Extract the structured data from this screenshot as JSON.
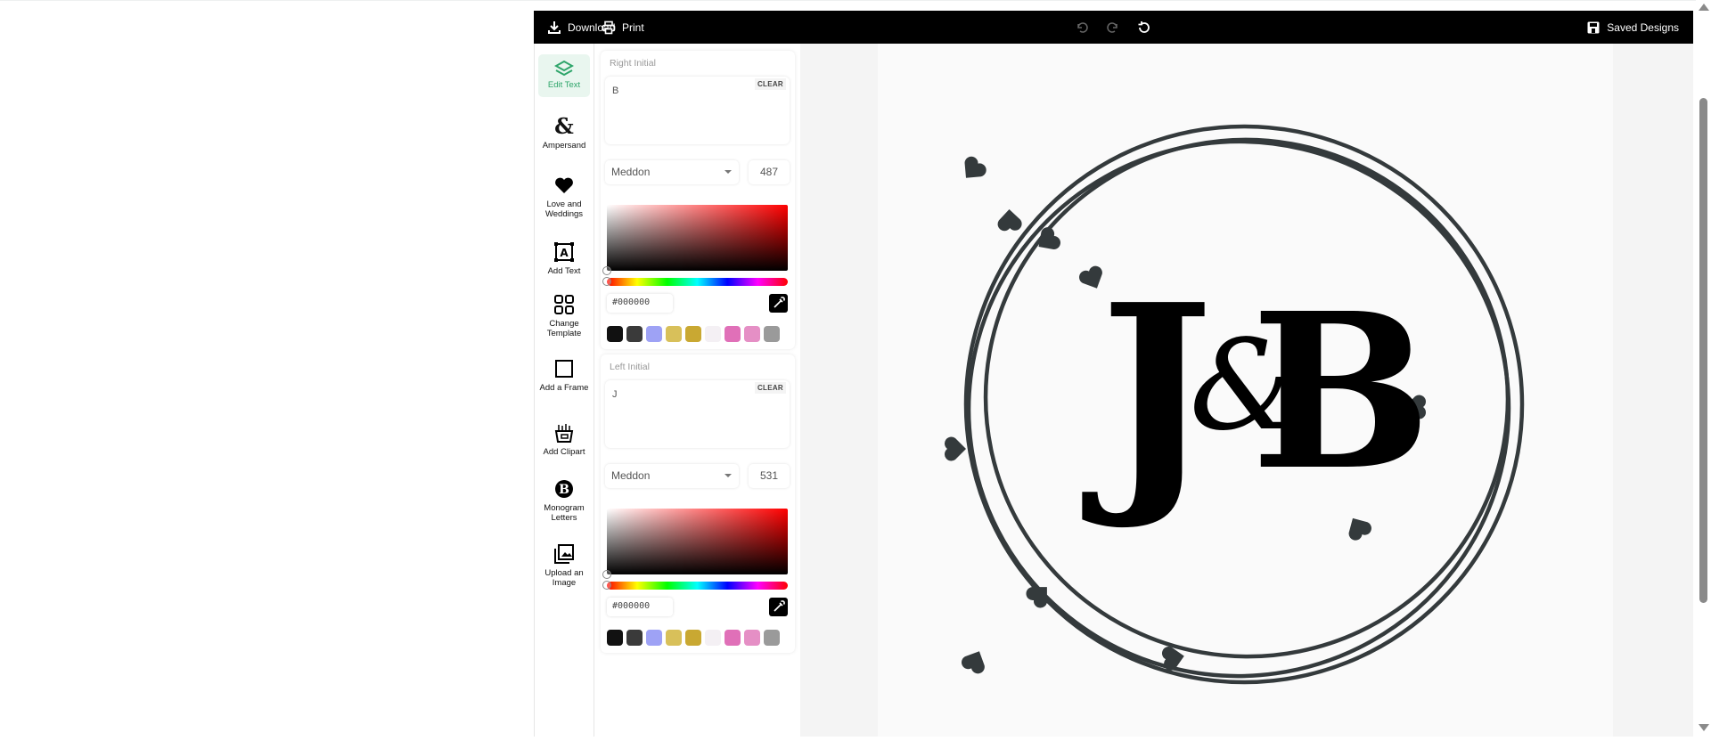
{
  "toolbar": {
    "download": "Download",
    "print": "Print",
    "saved_designs": "Saved Designs"
  },
  "sidebar": {
    "items": [
      {
        "label": "Edit Text",
        "icon": "layers-icon"
      },
      {
        "label": "Ampersand",
        "icon": "ampersand-icon"
      },
      {
        "label": "Love and Weddings",
        "icon": "heart-icon"
      },
      {
        "label": "Add Text",
        "icon": "text-box-icon"
      },
      {
        "label": "Change Template",
        "icon": "grid-icon"
      },
      {
        "label": "Add a Frame",
        "icon": "frame-icon"
      },
      {
        "label": "Add Clipart",
        "icon": "clipart-icon"
      },
      {
        "label": "Monogram Letters",
        "icon": "monogram-icon"
      },
      {
        "label": "Upload an Image",
        "icon": "image-upload-icon"
      }
    ]
  },
  "panels": [
    {
      "label": "Right Initial",
      "text": "B",
      "clear": "CLEAR",
      "font": "Meddon",
      "size": "487",
      "hex": "#000000"
    },
    {
      "label": "Left Initial",
      "text": "J",
      "clear": "CLEAR",
      "font": "Meddon",
      "size": "531",
      "hex": "#000000"
    }
  ],
  "swatches": [
    "#111111",
    "#3a3a3a",
    "#9ea2f5",
    "#d8c05a",
    "#c9a832",
    "#f4f0f4",
    "#e070b8",
    "#e58fc5",
    "#9a9a9a"
  ],
  "monogram": {
    "left": "J",
    "ampersand": "&",
    "right": "B",
    "frame_color": "#343a3c",
    "accent": "#2ea56a"
  }
}
